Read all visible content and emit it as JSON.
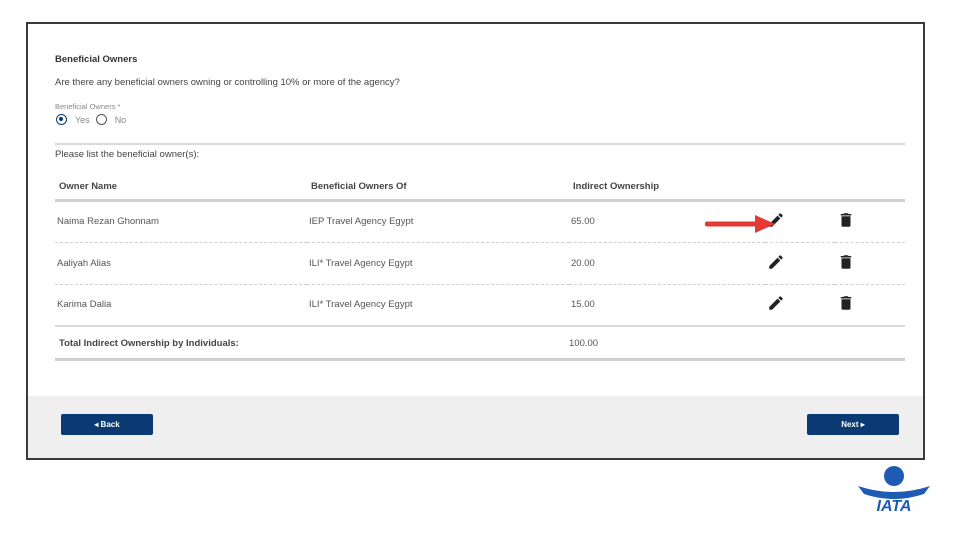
{
  "section": {
    "title": "Beneficial Owners",
    "question": "Are there any beneficial owners owning or controlling 10% or more of the agency?",
    "field_label": "Beneficial Owners *",
    "options": [
      {
        "label": "Yes",
        "selected": true
      },
      {
        "label": "No",
        "selected": false
      }
    ]
  },
  "list_prompt": "Please list the beneficial owner(s):",
  "table": {
    "columns": [
      "Owner Name",
      "Beneficial Owners Of",
      "Indirect Ownership"
    ],
    "rows": [
      {
        "name": "Naima Rezan Ghonnam",
        "of": "IEP Travel Agency Egypt",
        "ownership": "65.00"
      },
      {
        "name": "Aaliyah Alias",
        "of": "ILI* Travel Agency Egypt",
        "ownership": "20.00"
      },
      {
        "name": "Karima Dalia",
        "of": "ILI* Travel Agency Egypt",
        "ownership": "15.00"
      }
    ]
  },
  "total": {
    "label": "Total Indirect Ownership by Individuals:",
    "value": "100.00"
  },
  "footer": {
    "back_label": "◂ Back",
    "next_label": "Next ▸"
  },
  "icons": {
    "edit": "pencil-icon",
    "delete": "trash-icon",
    "annotation": "red-arrow"
  },
  "colors": {
    "primary": "#0b3a73",
    "annotation_arrow": "#e53935",
    "logo": "#1e5bb5"
  },
  "logo_text": "IATA"
}
